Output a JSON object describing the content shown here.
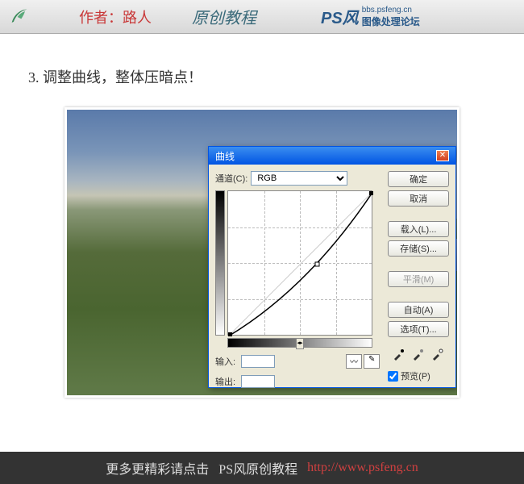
{
  "header": {
    "author_label": "作者：路人",
    "tutorial_label": "原创教程",
    "brand": "PS风",
    "brand_url": "bbs.psfeng.cn",
    "brand_sub": "图像处理论坛"
  },
  "step": {
    "title": "3. 调整曲线，整体压暗点！"
  },
  "dialog": {
    "title": "曲线",
    "channel_label": "通道(C):",
    "channel_value": "RGB",
    "input_label": "输入:",
    "output_label": "输出:",
    "buttons": {
      "ok": "确定",
      "cancel": "取消",
      "load": "载入(L)...",
      "save": "存储(S)...",
      "smooth": "平滑(M)",
      "auto": "自动(A)",
      "options": "选项(T)..."
    },
    "preview_label": "预览(P)"
  },
  "footer": {
    "text1": "更多更精彩请点击",
    "text2": "PS风原创教程",
    "link": "http://www.psfeng.cn"
  }
}
